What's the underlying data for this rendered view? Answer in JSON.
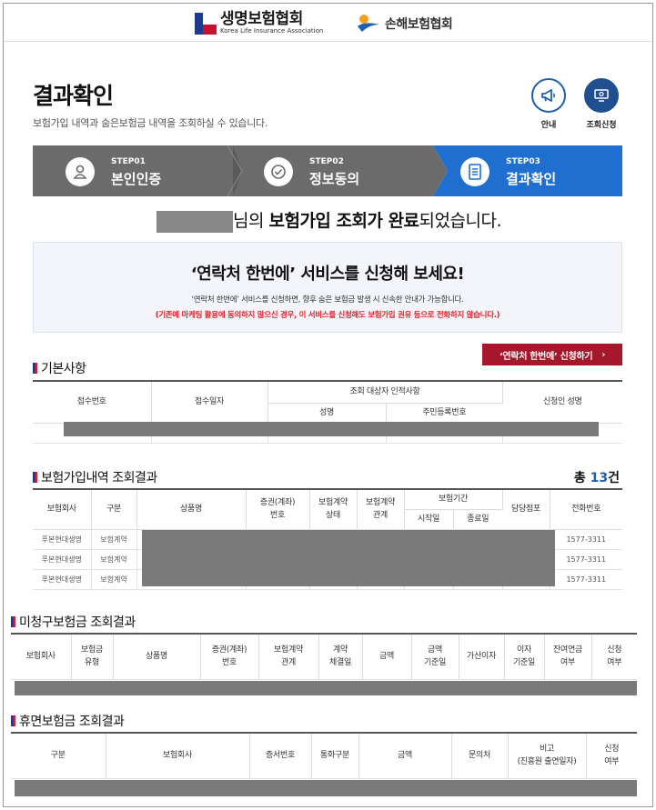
{
  "header": {
    "life_logo_text": "생명보험협회",
    "life_logo_sub": "Korea Life Insurance Association",
    "nonlife_logo_text": "손해보험협회"
  },
  "page": {
    "title": "결과확인",
    "description": "보험가입 내역과 숨은보험금 내역을 조회하실 수 있습니다.",
    "guide_label": "안내",
    "inquiry_label": "조회신청"
  },
  "steps": [
    {
      "num": "STEP01",
      "name": "본인인증"
    },
    {
      "num": "STEP02",
      "name": "정보동의"
    },
    {
      "num": "STEP03",
      "name": "결과확인"
    }
  ],
  "colors": {
    "step_inactive": "#6b6b6b",
    "step_active": "#1f6fd1",
    "accent": "#a5182b"
  },
  "done_message": {
    "suffix_name": "님의 ",
    "bold": "보험가입 조회가 완료",
    "rest": "되었습니다."
  },
  "promo": {
    "heading": "‘연락처 한번에’ 서비스를 신청해 보세요!",
    "line1": "‘연락처 한번에’ 서비스를 신청하면, 향후 숨은 보험금 발생 시 신속한 안내가 가능합니다.",
    "line2": "(기존에 마케팅 활용에 동의하지 않으신 경우, 이 서비스를 신청해도 보험가입 권유 등으로 전화하지 않습니다.)",
    "button": "‘연락처 한번에’ 신청하기"
  },
  "basic": {
    "title": "기본사항",
    "headers": {
      "receipt_no": "접수번호",
      "receipt_date": "접수일자",
      "target_group": "조회 대상자 인적사항",
      "name": "성명",
      "rrn": "주민등록번호",
      "applicant": "신청인 성명"
    }
  },
  "joined": {
    "title": "보험가입내역 조회결과",
    "total_prefix": "총 ",
    "total_count": "13",
    "total_suffix": "건",
    "headers": {
      "company": "보험회사",
      "category": "구분",
      "product": "상품명",
      "policy1": "증권(계좌)",
      "policy2": "번호",
      "contract_status1": "보험계약",
      "contract_status2": "상태",
      "contract_rel1": "보험계약",
      "contract_rel2": "관계",
      "period": "보험기간",
      "start": "시작일",
      "end": "종료일",
      "branch": "담당점포",
      "phone": "전화번호"
    },
    "rows": [
      {
        "company": "푸본현대생명",
        "category": "보험계약",
        "phone": "1577-3311"
      },
      {
        "company": "푸본현대생명",
        "category": "보험계약",
        "phone": "1577-3311"
      },
      {
        "company": "푸본현대생명",
        "category": "보험계약",
        "phone": "1577-3311"
      }
    ]
  },
  "unclaimed": {
    "title": "미청구보험금 조회결과",
    "headers": {
      "company": "보험회사",
      "type1": "보험금",
      "type2": "유형",
      "product": "상품명",
      "policy1": "증권(계좌)",
      "policy2": "번호",
      "rel1": "보험계약",
      "rel2": "관계",
      "contract_date1": "계약",
      "contract_date2": "체결일",
      "amount": "금액",
      "amount_date1": "금액",
      "amount_date2": "기준일",
      "interest": "가산이자",
      "interest_date1": "이자",
      "interest_date2": "기준일",
      "annuity1": "잔여연금",
      "annuity2": "여부",
      "apply1": "신청",
      "apply2": "여부"
    }
  },
  "dormant": {
    "title": "휴면보험금 조회결과",
    "headers": {
      "category": "구분",
      "company": "보험회사",
      "cert_no": "증서번호",
      "currency": "통화구분",
      "amount": "금액",
      "contact": "문의처",
      "note1": "비고",
      "note2": "(진흥원 출연일자)",
      "apply1": "신청",
      "apply2": "여부"
    }
  }
}
